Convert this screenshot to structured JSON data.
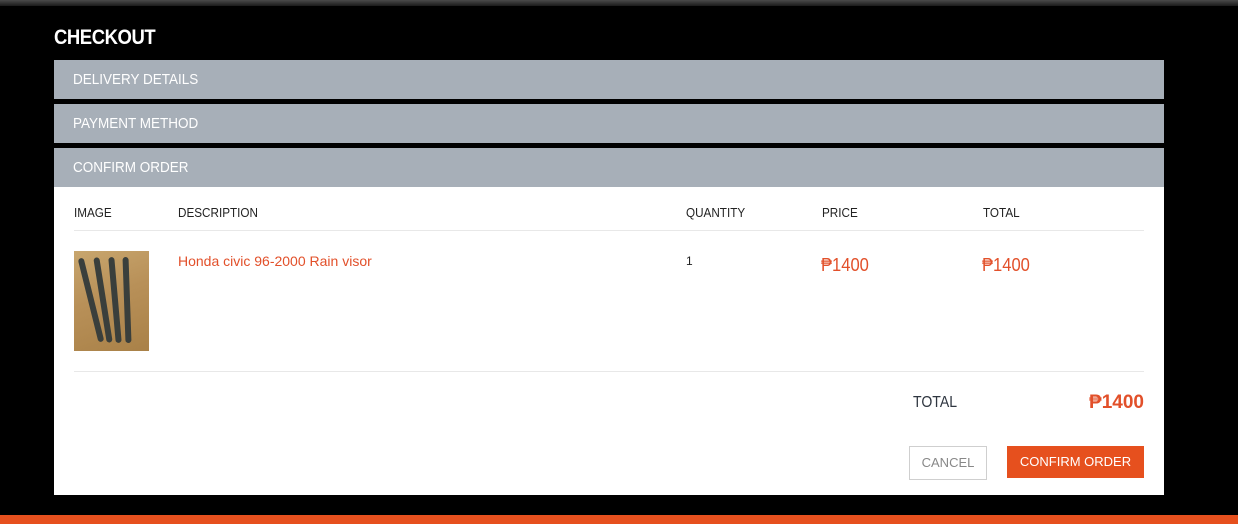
{
  "page": {
    "title": "CHECKOUT"
  },
  "panels": {
    "delivery": "DELIVERY DETAILS",
    "payment": "PAYMENT METHOD",
    "confirm": "CONFIRM ORDER"
  },
  "table": {
    "headers": {
      "image": "IMAGE",
      "description": "DESCRIPTION",
      "quantity": "QUANTITY",
      "price": "PRICE",
      "total": "TOTAL"
    },
    "rows": [
      {
        "image": "rain-visor-product-photo",
        "description": "Honda civic 96-2000 Rain visor",
        "quantity": "1",
        "price": "₱1400",
        "total": "₱1400"
      }
    ]
  },
  "summary": {
    "total_label": "TOTAL",
    "total_value": "₱1400"
  },
  "actions": {
    "cancel": "CANCEL",
    "confirm": "CONFIRM ORDER"
  },
  "colors": {
    "accent": "#e6501e",
    "link": "#e2502a",
    "panel_header": "#a7afb8",
    "background": "#000000"
  }
}
